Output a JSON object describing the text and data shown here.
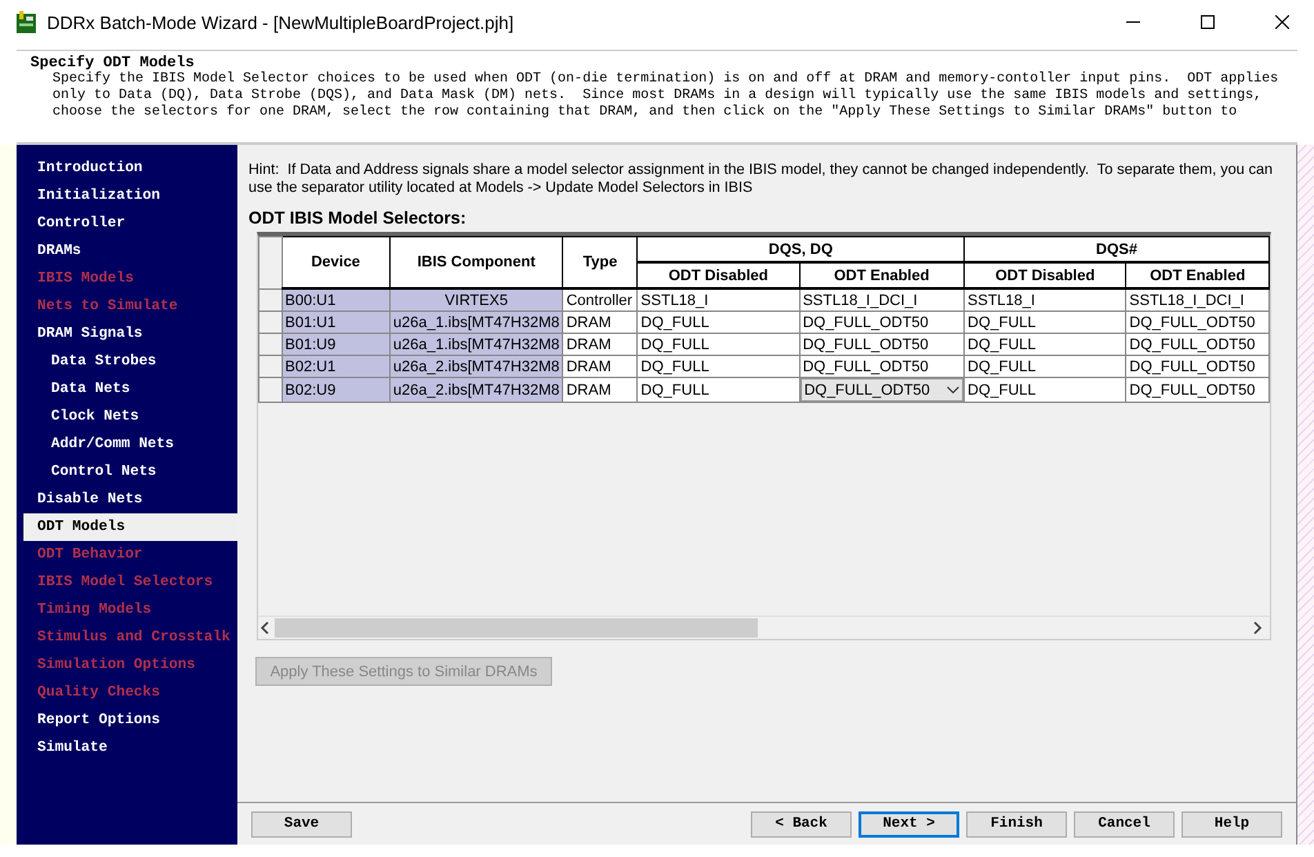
{
  "window": {
    "title": "DDRx Batch-Mode Wizard - [NewMultipleBoardProject.pjh]"
  },
  "header": {
    "title": "Specify ODT Models",
    "description": "Specify the IBIS Model Selector choices to be used when ODT (on-die termination) is on and off at DRAM and memory-contoller input pins.  ODT applies only to Data (DQ), Data Strobe (DQS), and Data Mask (DM) nets.  Since most DRAMs in a design will typically use the same IBIS models and settings, choose the selectors for one DRAM, select the row containing that DRAM, and then click on the \"Apply These Settings to Similar DRAMs\" button to"
  },
  "sidebar": {
    "items": [
      {
        "label": "Introduction",
        "enabled": true,
        "selected": false
      },
      {
        "label": "Initialization",
        "enabled": true,
        "selected": false
      },
      {
        "label": "Controller",
        "enabled": true,
        "selected": false
      },
      {
        "label": "DRAMs",
        "enabled": true,
        "selected": false
      },
      {
        "label": "IBIS Models",
        "enabled": false,
        "selected": false
      },
      {
        "label": "Nets to Simulate",
        "enabled": false,
        "selected": false
      },
      {
        "label": "DRAM Signals",
        "enabled": true,
        "selected": false,
        "children": [
          {
            "label": "Data Strobes",
            "enabled": true,
            "selected": false
          },
          {
            "label": "Data Nets",
            "enabled": true,
            "selected": false
          },
          {
            "label": "Clock Nets",
            "enabled": true,
            "selected": false
          },
          {
            "label": "Addr/Comm Nets",
            "enabled": true,
            "selected": false
          },
          {
            "label": "Control Nets",
            "enabled": true,
            "selected": false
          }
        ]
      },
      {
        "label": "Disable Nets",
        "enabled": true,
        "selected": false
      },
      {
        "label": "ODT Models",
        "enabled": true,
        "selected": true
      },
      {
        "label": "ODT Behavior",
        "enabled": false,
        "selected": false
      },
      {
        "label": "IBIS Model Selectors",
        "enabled": false,
        "selected": false
      },
      {
        "label": "Timing Models",
        "enabled": false,
        "selected": false
      },
      {
        "label": "Stimulus and Crosstalk",
        "enabled": false,
        "selected": false
      },
      {
        "label": "Simulation Options",
        "enabled": false,
        "selected": false
      },
      {
        "label": "Quality Checks",
        "enabled": false,
        "selected": false
      },
      {
        "label": "Report Options",
        "enabled": true,
        "selected": false
      },
      {
        "label": "Simulate",
        "enabled": true,
        "selected": false
      }
    ]
  },
  "hint": "Hint:  If Data and Address signals share a model selector assignment in the IBIS model, they cannot be changed independently.  To separate them, you can use the separator utility located at Models -> Update Model Selectors in IBIS",
  "table": {
    "title": "ODT IBIS Model Selectors:",
    "columns": [
      "Device",
      "IBIS Component",
      "Type"
    ],
    "groups": [
      {
        "label": "DQS, DQ",
        "columns": [
          "ODT Disabled",
          "ODT Enabled"
        ]
      },
      {
        "label": "DQS#",
        "columns": [
          "ODT Disabled",
          "ODT Enabled"
        ]
      }
    ],
    "rows": [
      {
        "device": "B00:U1",
        "component": "VIRTEX5",
        "type": "Controller",
        "values": [
          {
            "text": "SSTL18_I",
            "kind": "text"
          },
          {
            "text": "SSTL18_I_DCI_I",
            "kind": "text"
          },
          {
            "text": "SSTL18_I",
            "kind": "text"
          },
          {
            "text": "SSTL18_I_DCI_I",
            "kind": "text"
          }
        ]
      },
      {
        "device": "B01:U1",
        "component": "u26a_1.ibs[MT47H32M8",
        "type": "DRAM",
        "values": [
          {
            "text": "DQ_FULL",
            "kind": "text"
          },
          {
            "text": "DQ_FULL_ODT50",
            "kind": "text"
          },
          {
            "text": "DQ_FULL",
            "kind": "text"
          },
          {
            "text": "DQ_FULL_ODT50",
            "kind": "text"
          }
        ]
      },
      {
        "device": "B01:U9",
        "component": "u26a_1.ibs[MT47H32M8",
        "type": "DRAM",
        "values": [
          {
            "text": "DQ_FULL",
            "kind": "text"
          },
          {
            "text": "DQ_FULL_ODT50",
            "kind": "text"
          },
          {
            "text": "DQ_FULL",
            "kind": "text"
          },
          {
            "text": "DQ_FULL_ODT50",
            "kind": "text"
          }
        ]
      },
      {
        "device": "B02:U1",
        "component": "u26a_2.ibs[MT47H32M8",
        "type": "DRAM",
        "values": [
          {
            "text": "DQ_FULL",
            "kind": "text"
          },
          {
            "text": "DQ_FULL_ODT50",
            "kind": "text"
          },
          {
            "text": "DQ_FULL",
            "kind": "text"
          },
          {
            "text": "DQ_FULL_ODT50",
            "kind": "text"
          }
        ]
      },
      {
        "device": "B02:U9",
        "component": "u26a_2.ibs[MT47H32M8",
        "type": "DRAM",
        "values": [
          {
            "text": "DQ_FULL",
            "kind": "text"
          },
          {
            "text": "DQ_FULL_ODT50",
            "kind": "dropdown"
          },
          {
            "text": "DQ_FULL",
            "kind": "text"
          },
          {
            "text": "DQ_FULL_ODT50",
            "kind": "text"
          }
        ]
      }
    ]
  },
  "apply_button": {
    "label": "Apply These Settings to Similar DRAMs",
    "disabled": true
  },
  "footer": {
    "left": [
      {
        "label": "Save",
        "selected": false
      }
    ],
    "right": [
      {
        "label": "< Back",
        "selected": false
      },
      {
        "label": "Next >",
        "selected": true
      },
      {
        "label": "Finish",
        "selected": false
      },
      {
        "label": "Cancel",
        "selected": false
      },
      {
        "label": "Help",
        "selected": false
      }
    ]
  }
}
